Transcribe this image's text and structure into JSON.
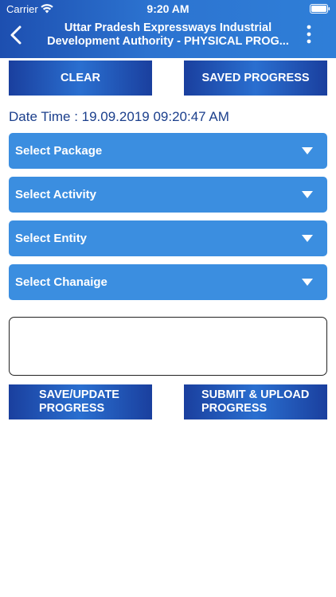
{
  "status_bar": {
    "carrier": "Carrier",
    "time": "9:20 AM"
  },
  "nav": {
    "title_line1": "Uttar Pradesh Expressways Industrial",
    "title_line2": "Development Authority - PHYSICAL PROG..."
  },
  "buttons": {
    "clear": "CLEAR",
    "saved_progress": "SAVED PROGRESS",
    "save_update_line1": "SAVE/UPDATE",
    "save_update_line2": "PROGRESS",
    "submit_line1": "SUBMIT & UPLOAD",
    "submit_line2": "PROGRESS"
  },
  "datetime": "Date Time : 19.09.2019 09:20:47 AM",
  "selects": [
    {
      "label": "Select Package"
    },
    {
      "label": "Select Activity"
    },
    {
      "label": "Select Entity"
    },
    {
      "label": "Select Chanaige"
    }
  ],
  "remarks": {
    "value": "",
    "placeholder": ""
  },
  "colors": {
    "header": "#2c73d0",
    "select_bg": "#3b8ee0",
    "button_dark": "#1a3f9e",
    "datetime_text": "#1b3f8c"
  },
  "icons": {
    "back": "chevron-left-icon",
    "more": "more-vertical-icon",
    "dropdown": "triangle-down-icon",
    "wifi": "wifi-icon",
    "battery": "battery-icon"
  }
}
